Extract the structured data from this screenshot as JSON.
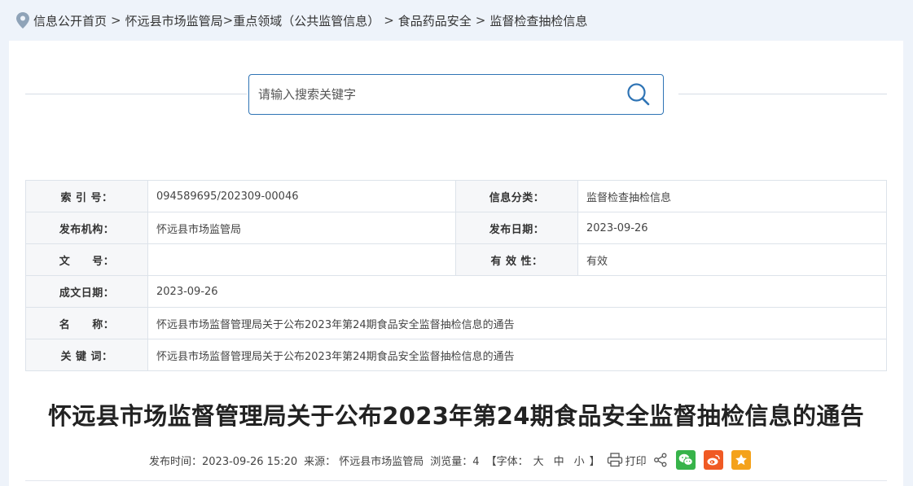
{
  "breadcrumb": {
    "items": [
      "信息公开首页",
      "怀远县市场监管局",
      "重点领域（公共监管信息）",
      "食品药品安全",
      "监督检查抽检信息"
    ]
  },
  "search": {
    "placeholder": "请输入搜索关键字"
  },
  "info": {
    "index_label": "索 引 号：",
    "index_value": "094589695/202309-00046",
    "category_label": "信息分类：",
    "category_value": "监督检查抽检信息",
    "publisher_label": "发布机构：",
    "publisher_value": "怀远县市场监管局",
    "pubdate_label": "发布日期：",
    "pubdate_value": "2023-09-26",
    "docno_label": "文　　号：",
    "docno_value": "",
    "validity_label": "有 效 性：",
    "validity_value": "有效",
    "created_label": "成文日期：",
    "created_value": "2023-09-26",
    "name_label": "名　　称：",
    "name_value": "怀远县市场监督管理局关于公布2023年第24期食品安全监督抽检信息的通告",
    "keywords_label": "关 键 词：",
    "keywords_value": "怀远县市场监督管理局关于公布2023年第24期食品安全监督抽检信息的通告"
  },
  "article": {
    "title": "怀远县市场监督管理局关于公布2023年第24期食品安全监督抽检信息的通告"
  },
  "meta": {
    "time": "发布时间：2023-09-26 15:20",
    "source": "来源： 怀远县市场监管局",
    "views": "浏览量：4",
    "font_open": "【字体：",
    "font_large": "大",
    "font_medium": "中",
    "font_small": "小",
    "font_close": "】",
    "print": "打印"
  },
  "colors": {
    "accent": "#2f74b5",
    "wechat": "#37b34a",
    "weibo": "#f05a24",
    "favorite": "#f4a21b"
  }
}
